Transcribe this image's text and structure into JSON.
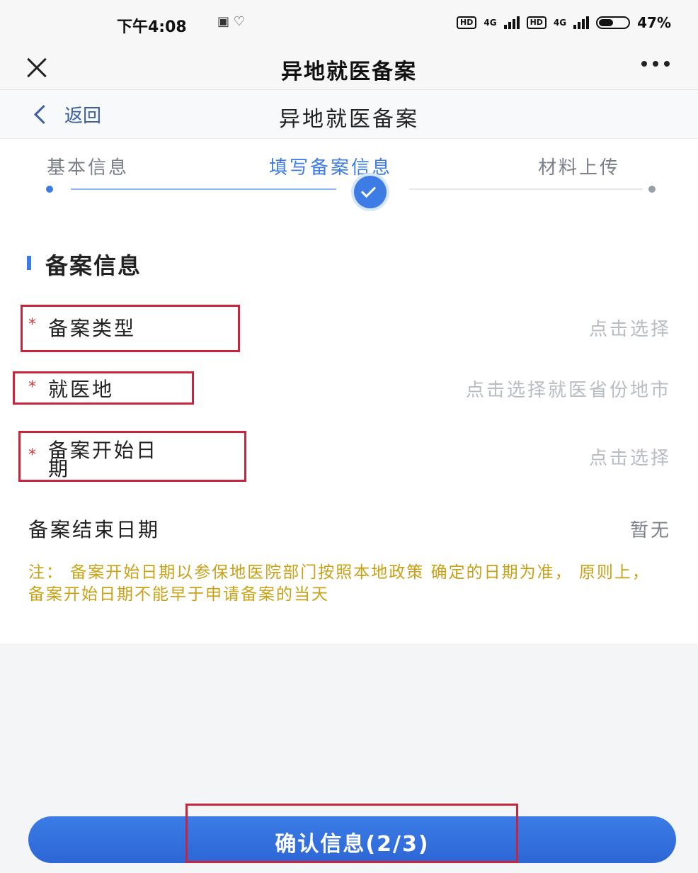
{
  "status_bar": {
    "time": "下午4:08",
    "notification": "▣  ♡",
    "network_1": "4G",
    "network_2": "4G",
    "battery": "47%",
    "hd_badge": "HD"
  },
  "nav": {
    "title": "异地就医备案"
  },
  "page_header": {
    "back_label": "返回",
    "title": "异地就医备案"
  },
  "steps": {
    "items": [
      {
        "label": "基本信息",
        "state": "done"
      },
      {
        "label": "填写备案信息",
        "state": "current"
      },
      {
        "label": "材料上传",
        "state": "todo"
      }
    ],
    "accent_color": "#3d7ce4"
  },
  "form": {
    "section_title": "备案信息",
    "required_mark": "*",
    "fields": [
      {
        "label": "备案类型",
        "value": "点击选择",
        "required": true
      },
      {
        "label": "就医地",
        "value": "点击选择就医省份地市",
        "required": true
      },
      {
        "label_line1": "备案开始日",
        "label_line2": "期",
        "value": "点击选择",
        "required": true
      },
      {
        "label": "备案结束日期",
        "value": "暂无",
        "required": false
      }
    ],
    "note": "注： 备案开始日期以参保地医院部门按照本地政策 确定的日期为准， 原则上， 备案开始日期不能早于申请备案的当天"
  },
  "footer": {
    "confirm_label": "确认信息(2/3)"
  }
}
